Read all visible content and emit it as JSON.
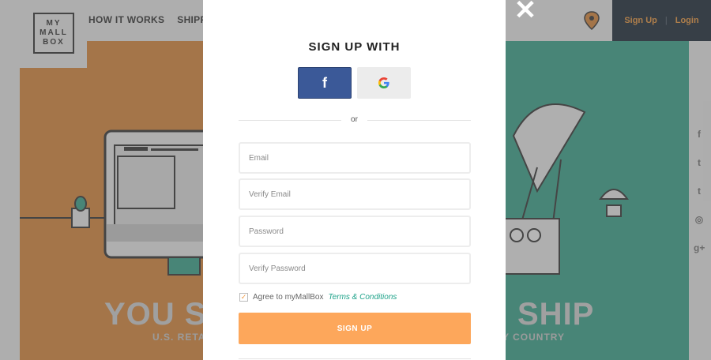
{
  "header": {
    "logo_lines": [
      "MY",
      "MALL",
      "BOX"
    ],
    "nav": [
      "HOW IT WORKS",
      "SHIPPI"
    ],
    "signup_label": "Sign Up",
    "login_label": "Login",
    "separator": "|"
  },
  "hero": {
    "left_text": "YOU S",
    "right_text": "SHIP",
    "left_sub": "U.S. RETAI",
    "right_sub": "Y COUNTRY"
  },
  "social_sidebar": [
    "f",
    "t",
    "t",
    "◎",
    "g+"
  ],
  "modal": {
    "close_symbol": "✕",
    "title": "SIGN UP WITH",
    "facebook_label": "f",
    "google_label": "G",
    "or_label": "or",
    "email_placeholder": "Email",
    "verify_email_placeholder": "Verify Email",
    "password_placeholder": "Password",
    "verify_password_placeholder": "Verify Password",
    "agree_text": "Agree to myMallBox",
    "terms_link": "Terms & Conditions",
    "agree_checked": true,
    "checkmark": "✓",
    "signup_button": "SIGN UP"
  },
  "colors": {
    "facebook": "#3b5998",
    "accent_orange": "#fda75b",
    "terms_green": "#1fa38a",
    "hero_orange": "#e08a3b",
    "hero_teal": "#3aa88f",
    "auth_bar": "#1b2838"
  }
}
